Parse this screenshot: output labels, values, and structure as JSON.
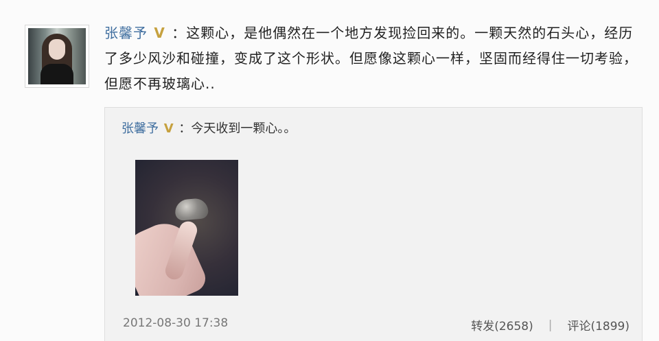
{
  "author": "张馨予",
  "verified_badge": "V",
  "post_text": "：这颗心，是他偶然在一个地方发现捡回来的。一颗天然的石头心，经历了多少风沙和碰撞，变成了这个形状。但愿像这颗心一样，坚固而经得住一切考验，但愿不再玻璃心..",
  "repost": {
    "author": "张馨予",
    "verified_badge": "V",
    "text": "：今天收到一颗心。。"
  },
  "meta": {
    "timestamp": "2012-08-30 17:38",
    "forward": "转发(2658)",
    "divider": "|",
    "comment": "评论(1899)"
  },
  "colors": {
    "link": "#3f6e9f",
    "verified": "#c6a13f",
    "background": "#fbfbfb",
    "repost_bg": "#f2f2f2"
  }
}
